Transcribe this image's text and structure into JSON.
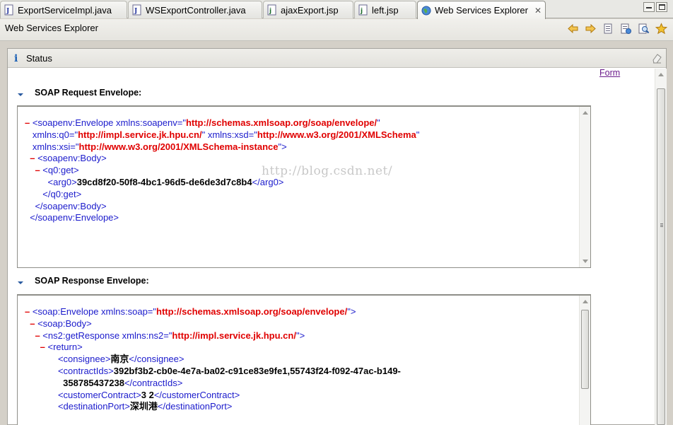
{
  "tabs": [
    {
      "label": "ExportServiceImpl.java",
      "icon": "java-file-icon"
    },
    {
      "label": "WSExportController.java",
      "icon": "java-file-icon"
    },
    {
      "label": "ajaxExport.jsp",
      "icon": "jsp-file-icon"
    },
    {
      "label": "left.jsp",
      "icon": "jsp-file-icon"
    },
    {
      "label": "Web Services Explorer",
      "icon": "globe-icon",
      "close": "✕",
      "active": true
    }
  ],
  "explorer": {
    "title": "Web Services Explorer",
    "toolbar": [
      "back-arrow-icon",
      "forward-arrow-icon",
      "wsdl-page-icon",
      "uddi-page-icon",
      "search-page-icon",
      "favorites-star-icon"
    ]
  },
  "status": {
    "info_glyph": "i",
    "label": "Status",
    "form_link": "Form"
  },
  "request": {
    "title": "SOAP Request Envelope:",
    "lines": [
      {
        "segs": [
          [
            "mk",
            "– "
          ],
          [
            "t",
            "<soapenv:Envelope xmlns:soapenv=\""
          ],
          [
            "av",
            "http://schemas.xmlsoap.org/soap/envelope/"
          ],
          [
            "t",
            "\""
          ]
        ]
      },
      {
        "segs": [
          [
            "t",
            "   xmlns:q0=\""
          ],
          [
            "av",
            "http://impl.service.jk.hpu.cn/"
          ],
          [
            "t",
            "\" xmlns:xsd=\""
          ],
          [
            "av",
            "http://www.w3.org/2001/XMLSchema"
          ],
          [
            "t",
            "\""
          ]
        ]
      },
      {
        "segs": [
          [
            "t",
            "   xmlns:xsi=\""
          ],
          [
            "av",
            "http://www.w3.org/2001/XMLSchema-instance"
          ],
          [
            "t",
            "\">"
          ]
        ]
      },
      {
        "segs": [
          [
            "mk",
            "  – "
          ],
          [
            "t",
            "<soapenv:Body>"
          ]
        ]
      },
      {
        "segs": [
          [
            "mk",
            "    – "
          ],
          [
            "t",
            "<q0:get>"
          ]
        ]
      },
      {
        "segs": [
          [
            "t",
            "         <arg0>"
          ],
          [
            "tx",
            "39cd8f20-50f8-4bc1-96d5-de6de3d7c8b4"
          ],
          [
            "t",
            "</arg0>"
          ]
        ]
      },
      {
        "segs": [
          [
            "t",
            "       </q0:get>"
          ]
        ]
      },
      {
        "segs": [
          [
            "t",
            "    </soapenv:Body>"
          ]
        ]
      },
      {
        "segs": [
          [
            "t",
            "  </soapenv:Envelope>"
          ]
        ]
      }
    ]
  },
  "response": {
    "title": "SOAP Response Envelope:",
    "lines": [
      {
        "segs": [
          [
            "mk",
            "– "
          ],
          [
            "t",
            "<soap:Envelope xmlns:soap=\""
          ],
          [
            "av",
            "http://schemas.xmlsoap.org/soap/envelope/"
          ],
          [
            "t",
            "\">"
          ]
        ]
      },
      {
        "segs": [
          [
            "mk",
            "  – "
          ],
          [
            "t",
            "<soap:Body>"
          ]
        ]
      },
      {
        "segs": [
          [
            "mk",
            "    – "
          ],
          [
            "t",
            "<ns2:getResponse xmlns:ns2=\""
          ],
          [
            "av",
            "http://impl.service.jk.hpu.cn/"
          ],
          [
            "t",
            "\">"
          ]
        ]
      },
      {
        "segs": [
          [
            "mk",
            "      – "
          ],
          [
            "t",
            "<return>"
          ]
        ]
      },
      {
        "segs": [
          [
            "t",
            "             <consignee>"
          ],
          [
            "tx",
            "南京"
          ],
          [
            "t",
            "</consignee>"
          ]
        ]
      },
      {
        "segs": [
          [
            "t",
            "             <contractIds>"
          ],
          [
            "tx",
            "392bf3b2-cb0e-4e7a-ba02-c91ce83e9fe1,55743f24-f092-47ac-b149-"
          ]
        ]
      },
      {
        "segs": [
          [
            "tx",
            "               358785437238"
          ],
          [
            "t",
            "</contractIds>"
          ]
        ]
      },
      {
        "segs": [
          [
            "t",
            "             <customerContract>"
          ],
          [
            "tx",
            "3 2"
          ],
          [
            "t",
            "</customerContract>"
          ]
        ]
      },
      {
        "segs": [
          [
            "t",
            "             <destinationPort>"
          ],
          [
            "tx",
            "深圳港"
          ],
          [
            "t",
            "</destinationPort>"
          ]
        ]
      }
    ]
  },
  "watermark": "http://blog.csdn.net/"
}
